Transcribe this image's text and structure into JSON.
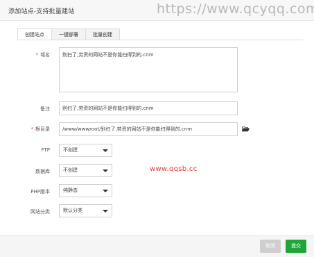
{
  "window": {
    "title": "添加站点-支持批量建站",
    "watermark": "https://www.qcyqq.com"
  },
  "tabs": [
    {
      "label": "创建站点",
      "active": true
    },
    {
      "label": "一键部署",
      "active": false
    },
    {
      "label": "批量创建",
      "active": false
    }
  ],
  "form": {
    "domain": {
      "label": "域名",
      "required": true,
      "value": "别扫了,劳资的网站不是你能扫得到的.cnm"
    },
    "note": {
      "label": "备注",
      "value": "别扫了,劳资的网站不是你能扫得到的.cnm"
    },
    "root": {
      "label": "根目录",
      "required": true,
      "value": "/www/wwwroot/别扫了,劳资的网站不是你能扫得到的.cnm",
      "icon": "folder-open-icon"
    },
    "ftp": {
      "label": "FTP",
      "value": "不创建"
    },
    "database": {
      "label": "数据库",
      "value": "不创建"
    },
    "php": {
      "label": "PHP版本",
      "value": "纯静态"
    },
    "category": {
      "label": "网站分类",
      "value": "默认分类"
    }
  },
  "overlay_watermark": "www.qqsb.cc",
  "footer": {
    "cancel_label": "取消",
    "submit_label": "提交"
  },
  "colors": {
    "required": "#e53935",
    "submit": "#20a53a",
    "cancel": "#cfcfcf",
    "watermark_mid": "#e53935"
  }
}
